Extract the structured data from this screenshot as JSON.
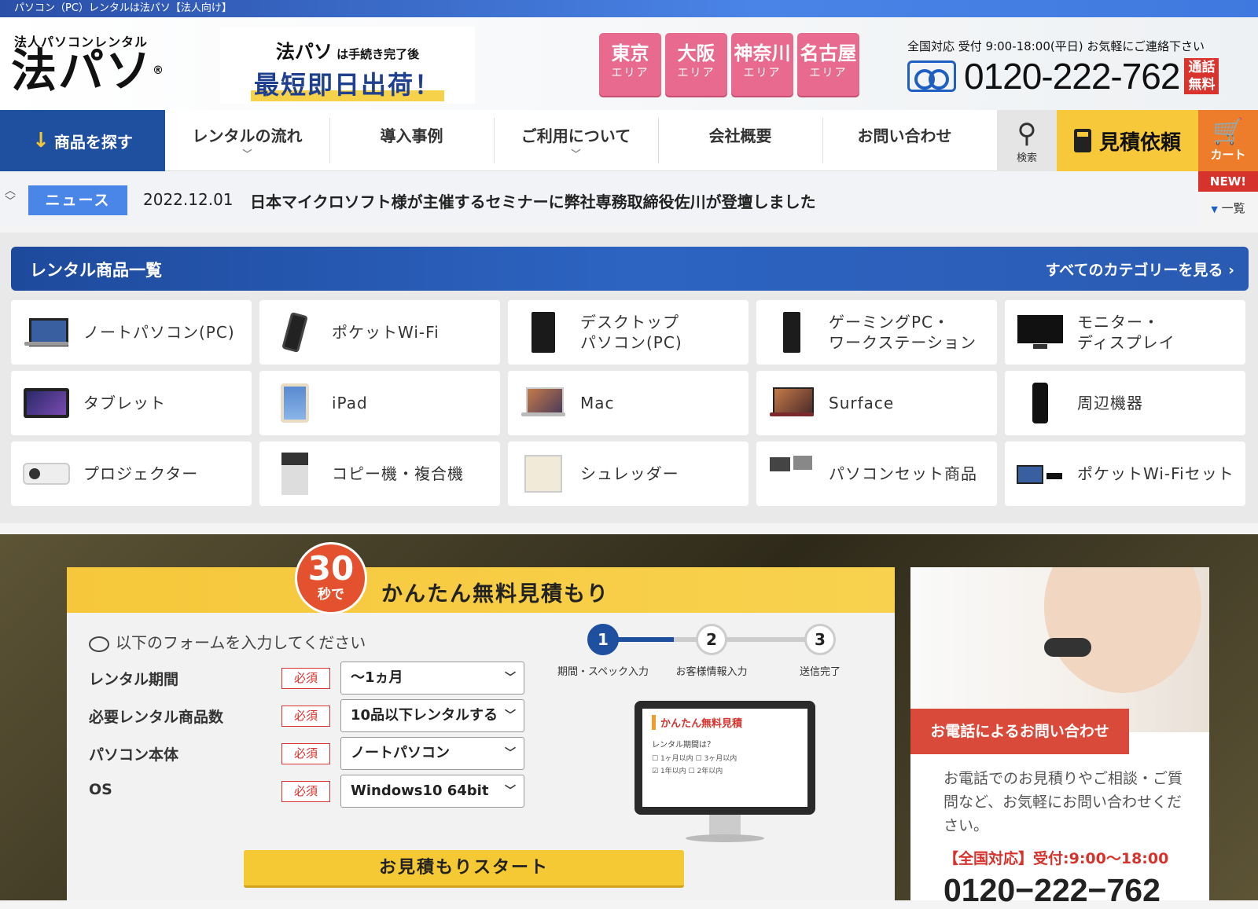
{
  "topbar": {
    "text": "パソコン（PC）レンタルは法パソ【法人向け】"
  },
  "logo": {
    "sub": "法人パソコンレンタル",
    "main": "法パソ",
    "mark": "®"
  },
  "banner": {
    "brand": "法パソ",
    "line1": "は手続き完了後",
    "line2": "最短即日出荷！"
  },
  "areas": [
    {
      "name": "東京",
      "sub": "エリア"
    },
    {
      "name": "大阪",
      "sub": "エリア"
    },
    {
      "name": "神奈川",
      "sub": "エリア"
    },
    {
      "name": "名古屋",
      "sub": "エリア"
    }
  ],
  "contact": {
    "note": "全国対応 受付 9:00-18:00(平日) お気軽にご連絡下さい",
    "phone": "0120-222-762",
    "free_tag": "通話無料"
  },
  "nav": {
    "find": "商品を探す",
    "items": [
      "レンタルの流れ",
      "導入事例",
      "ご利用について",
      "会社概要",
      "お問い合わせ"
    ],
    "search": "検索",
    "quote": "見積依頼",
    "cart": "カート",
    "new": "NEW!"
  },
  "news": {
    "label": "ニュース",
    "date": "2022.12.01",
    "text": "日本マイクロソフト様が主催するセミナーに弊社専務取締役佐川が登壇しました",
    "more": "一覧"
  },
  "catalog": {
    "title": "レンタル商品一覧",
    "all": "すべてのカテゴリーを見る ›",
    "items": [
      {
        "label": "ノートパソコン(PC)",
        "icon": "laptop-icon"
      },
      {
        "label": "ポケットWi-Fi",
        "icon": "pocket-wifi-icon"
      },
      {
        "label": "デスクトップ\nパソコン(PC)",
        "icon": "desktop-tower-icon"
      },
      {
        "label": "ゲーミングPC・\nワークステーション",
        "icon": "workstation-icon"
      },
      {
        "label": "モニター・\nディスプレイ",
        "icon": "monitor-icon"
      },
      {
        "label": "タブレット",
        "icon": "tablet-icon"
      },
      {
        "label": "iPad",
        "icon": "ipad-icon"
      },
      {
        "label": "Mac",
        "icon": "mac-icon"
      },
      {
        "label": "Surface",
        "icon": "surface-icon"
      },
      {
        "label": "周辺機器",
        "icon": "router-icon"
      },
      {
        "label": "プロジェクター",
        "icon": "projector-icon"
      },
      {
        "label": "コピー機・複合機",
        "icon": "copier-icon"
      },
      {
        "label": "シュレッダー",
        "icon": "shredder-icon"
      },
      {
        "label": "パソコンセット商品",
        "icon": "pc-set-icon"
      },
      {
        "label": "ポケットWi-Fiセット",
        "icon": "wifi-set-icon"
      }
    ]
  },
  "quote": {
    "badge_num": "30",
    "badge_sub": "秒で",
    "title": "かんたん無料見積もり",
    "hint": "以下のフォームを入力してください",
    "required": "必須",
    "fields": [
      {
        "label": "レンタル期間",
        "value": "〜1ヵ月"
      },
      {
        "label": "必要レンタル商品数",
        "value": "10品以下レンタルする"
      },
      {
        "label": "パソコン本体",
        "value": "ノートパソコン"
      },
      {
        "label": "OS",
        "value": "Windows10 64bit"
      }
    ],
    "steps": [
      {
        "num": "1",
        "label": "期間・スペック入力"
      },
      {
        "num": "2",
        "label": "お客様情報入力"
      },
      {
        "num": "3",
        "label": "送信完了"
      }
    ],
    "mini": {
      "title": "かんたん無料見積",
      "question": "レンタル期間は？",
      "opt1": "1ヶ月以内",
      "opt2": "3ヶ月以内",
      "opt3": "1年以内",
      "opt4": "2年以内"
    },
    "start": "お見積もりスタート"
  },
  "call": {
    "tag": "お電話によるお問い合わせ",
    "text": "お電話でのお見積りやご相談・ご質問など、お気軽にお問い合わせください。",
    "hours": "【全国対応】受付:9:00〜18:00",
    "phone": "0120−222−762"
  }
}
